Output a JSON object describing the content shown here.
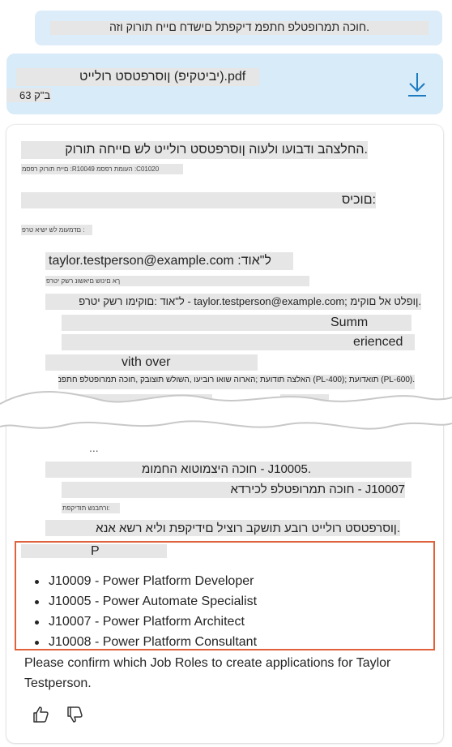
{
  "user_message": {
    "text": ".חוכה תמרופטלפ חתפמ דיקפתל םישדח םייח תורוק וזה"
  },
  "attachment": {
    "file_name": "pdf.(יביטקיפ) ןוסרפטסט רולייט",
    "file_size": "ב\"ק 63",
    "download_icon": "download-icon"
  },
  "response": {
    "heading": ".החלצהב ודבועו ולעוה ןוסרפטסט רולייט לש םייחה תורוק",
    "ids_small": "םייח תורוק רפסמ :R10049 העומת רפסמ :C01020",
    "summary_heading": ":םוכיס",
    "small_note": ": םדמעומ לש ישיא טרפ",
    "email_line": "taylor.testperson@example.com :ל\"אוד",
    "small_note2": "ךא םינוש םיאשונ רשק יטרפ",
    "contact_line": ".ןופלט אל םוקימ ;taylor.testperson@example.com - ל\"אוד :םוקימו רשק יטרפ",
    "summ_fragment": "Summ",
    "erienced_fragment": "erienced",
    "vith_over_fragment": "vith over",
    "certs_line": ".(PL-600) תואדועת ;(PL-400) האלצה תודועת ;הארוה שואו רוביעו ,השולש תוצובק ,חוכה תמרופטלפ חתפמ",
    "cut_partial_line": "...",
    "role_line_1": ".J10005 - חוכה היצמוטוא החמומ",
    "role_line_2": "J10007 - חוכה תמרופטלפ לכירדא",
    "small_note3": ":ורחבנש תודיקפת",
    "confirm_rtl": ".ןוסרפטסט רולייט רובע תושקב רוציל םידיקפת וליא רשא אנא",
    "p_fragment": "P",
    "roles": [
      "J10009 - Power Platform Developer",
      "J10005 - Power Automate Specialist",
      "J10007 - Power Platform Architect",
      "J10008 - Power Platform Consultant"
    ],
    "confirm_en": "Please confirm which Job Roles to create applications for Taylor Testperson."
  },
  "feedback": {
    "thumbs_up": "thumbs-up-icon",
    "thumbs_down": "thumbs-down-icon"
  },
  "colors": {
    "bubble_bg": "#dcecf8",
    "file_card_bg": "#d8ebf8",
    "download_icon": "#1b7ac0",
    "highlight_border": "#e0623c"
  }
}
